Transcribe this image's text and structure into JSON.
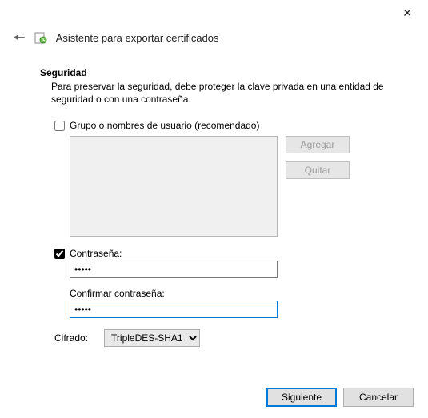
{
  "window": {
    "title": "Asistente para exportar certificados"
  },
  "section": {
    "title": "Seguridad",
    "description": "Para preservar la seguridad, debe proteger la clave privada en una entidad de seguridad o con una contraseña."
  },
  "group": {
    "label": "Grupo o nombres de usuario (recomendado)",
    "checked": false,
    "add": "Agregar",
    "remove": "Quitar"
  },
  "password": {
    "label": "Contraseña:",
    "checked": true,
    "value": "•••••",
    "confirm_label": "Confirmar contraseña:",
    "confirm_value": "•••••"
  },
  "cipher": {
    "label": "Cifrado:",
    "selected": "TripleDES-SHA1"
  },
  "footer": {
    "next": "Siguiente",
    "cancel": "Cancelar"
  }
}
